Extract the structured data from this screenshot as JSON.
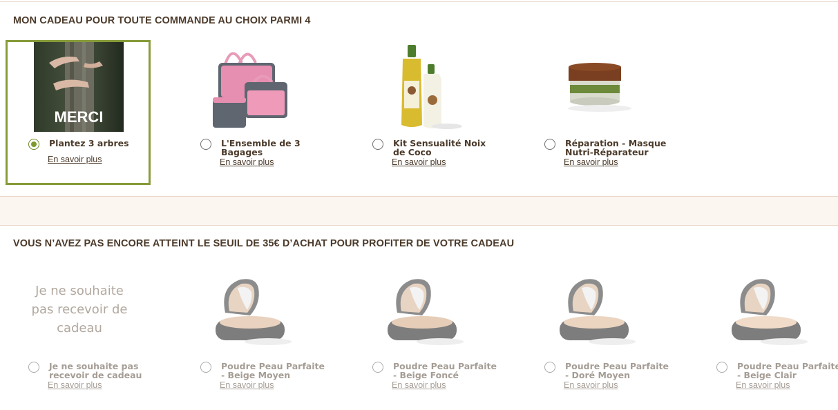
{
  "section1": {
    "title": "MON CADEAU POUR TOUTE COMMANDE AU CHOIX PARMI 4",
    "items": [
      {
        "label": "Plantez 3 arbres",
        "more": "En savoir plus",
        "selected": true,
        "image_text": "MERCI"
      },
      {
        "label": "L'Ensemble de 3 Bagages",
        "more": "En savoir plus",
        "selected": false
      },
      {
        "label": "Kit Sensualité Noix de Coco",
        "more": "En savoir plus",
        "selected": false
      },
      {
        "label": "Réparation - Masque Nutri-Réparateur",
        "more": "En savoir plus",
        "selected": false
      }
    ]
  },
  "section2": {
    "title": "VOUS N’AVEZ PAS ENCORE ATTEINT LE SEUIL DE 35€ D’ACHAT POUR PROFITER DE VOTRE CADEAU",
    "items": [
      {
        "label": "Je ne souhaite pas recevoir de cadeau",
        "more": "En savoir plus",
        "image_text": "Je ne souhaite pas recevoir de cadeau"
      },
      {
        "label": "Poudre Peau Parfaite - Beige Moyen",
        "more": "En savoir plus"
      },
      {
        "label": "Poudre Peau Parfaite - Beige Foncé",
        "more": "En savoir plus"
      },
      {
        "label": "Poudre Peau Parfaite - Doré Moyen",
        "more": "En savoir plus"
      },
      {
        "label": "Poudre Peau Parfaite - Beige Clair",
        "more": "En savoir plus"
      }
    ]
  },
  "colors": {
    "accent": "#879b3a",
    "band": "#fcf6f1",
    "text": "#4b3a2a",
    "muted": "#a59d95"
  }
}
